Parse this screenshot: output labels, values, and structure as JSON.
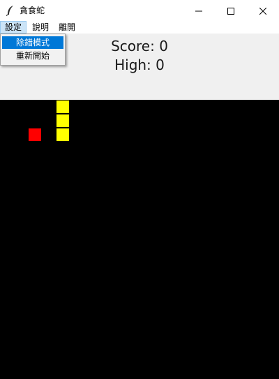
{
  "window": {
    "title": "貪食蛇",
    "controls": [
      "minimize-icon",
      "maximize-icon",
      "close-icon"
    ]
  },
  "menubar": {
    "items": [
      {
        "label": "設定"
      },
      {
        "label": "說明"
      },
      {
        "label": "離開"
      }
    ]
  },
  "dropdown": {
    "items": [
      {
        "label": "除錯模式",
        "highlighted": true
      },
      {
        "label": "重新開始",
        "highlighted": false
      }
    ]
  },
  "scoreboard": {
    "score": "Score: 0",
    "high": "High: 0"
  },
  "board": {
    "background": "#000000",
    "cell_size": 20,
    "snake_color": "#ffff00",
    "food_color": "#ff0000",
    "snake": [
      [
        4,
        0
      ],
      [
        4,
        1
      ],
      [
        4,
        2
      ]
    ],
    "food": [
      2,
      2
    ]
  }
}
